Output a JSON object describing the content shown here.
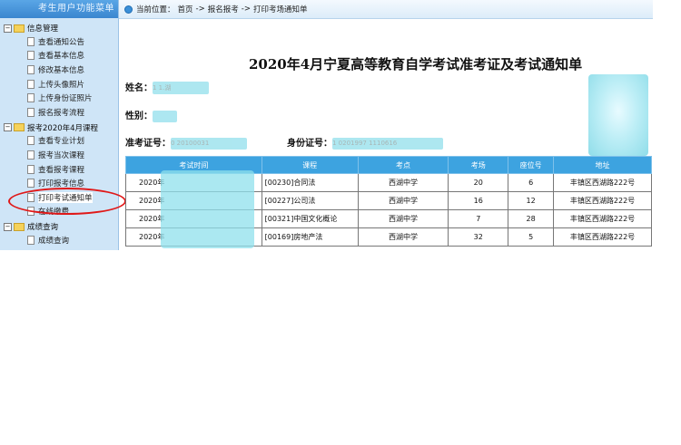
{
  "sidebar": {
    "header": "考生用户功能菜单",
    "groups": [
      {
        "toggle": "−",
        "label": "信息管理",
        "items": [
          "查看通知公告",
          "查看基本信息",
          "修改基本信息",
          "上传头像照片",
          "上传身份证照片",
          "报名报考流程"
        ]
      },
      {
        "toggle": "−",
        "label": "报考2020年4月课程",
        "items": [
          "查看专业计划",
          "报考当次课程",
          "查看报考课程",
          "打印报考信息",
          "打印考试通知单",
          "在线缴费"
        ]
      },
      {
        "toggle": "−",
        "label": "成绩查询",
        "items": [
          "成绩查询"
        ]
      }
    ]
  },
  "breadcrumb": {
    "prefix": "当前位置：",
    "home": "首页",
    "sep": "->",
    "level1": "报名报考",
    "level2": "打印考场通知单"
  },
  "page": {
    "title": "2020年4月宁夏高等教育自学考试准考证及考试通知单",
    "name_label": "姓名：",
    "name_value": "1 1.湖",
    "gender_label": "性别：",
    "gender_value": "",
    "ticket_label": "准考证号：",
    "ticket_value": "0 20100031",
    "id_label": "身份证号：",
    "id_value": "1 0201997 1110616"
  },
  "table": {
    "headers": [
      "考试时间",
      "课程",
      "考点",
      "考场",
      "座位号",
      "地址"
    ],
    "rows": [
      {
        "time": "2020年",
        "course": "[00230]合同法",
        "site": "西湖中学",
        "room": "20",
        "seat": "6",
        "addr": "丰镇区西湖路222号"
      },
      {
        "time": "2020年",
        "course": "[00227]公司法",
        "site": "西湖中学",
        "room": "16",
        "seat": "12",
        "addr": "丰镇区西湖路222号"
      },
      {
        "time": "2020年",
        "course": "[00321]中国文化概论",
        "site": "西湖中学",
        "room": "7",
        "seat": "28",
        "addr": "丰镇区西湖路222号"
      },
      {
        "time": "2020年",
        "course": "[00169]房地产法",
        "site": "西湖中学",
        "room": "32",
        "seat": "5",
        "addr": "丰镇区西湖路222号"
      }
    ]
  },
  "colors": {
    "header_blue": "#3da3e0",
    "sidebar_bg": "#cfe5f7",
    "highlight_red": "#e01818"
  }
}
